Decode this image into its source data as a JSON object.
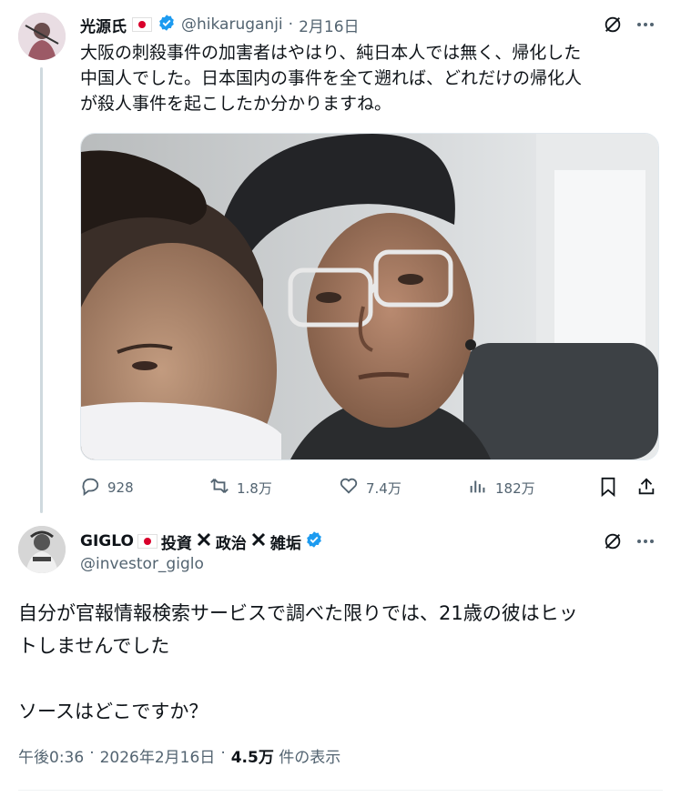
{
  "original_post": {
    "display_name": "光源氏",
    "handle": "@hikaruganji",
    "separator": "·",
    "date": "2月16日",
    "text_lines": [
      "大阪の刺殺事件の加害者はやはり、純日本人では無く、帰化した",
      "中国人でした。日本国内の事件を全て遡れば、どれだけの帰化人",
      "が殺人事件を起こしたか分かりますね。"
    ],
    "stats": {
      "replies": "928",
      "reposts": "1.8万",
      "likes": "7.4万",
      "views": "182万"
    }
  },
  "reply_post": {
    "display_name_prefix": "GIGLO",
    "display_name_suffix_parts": [
      "投資",
      "政治",
      "雑垢"
    ],
    "handle": "@investor_giglo",
    "text_lines": [
      "自分が官報情報検索サービスで調べた限りでは、21歳の彼はヒッ",
      "トしませんでした",
      "",
      "ソースはどこですか？"
    ],
    "time": "午後0:36",
    "sep1": "·",
    "date": "2026年2月16日",
    "sep2": "·",
    "views_count": "4.5万",
    "views_label": "件の表示"
  },
  "colors": {
    "verified_blue": "#1d9bf0",
    "secondary_text": "#536471",
    "flag_red": "#d9002b"
  },
  "icons": [
    "verified-icon",
    "flag-jp-icon",
    "grok-icon",
    "more-icon",
    "reply-icon",
    "repost-icon",
    "like-icon",
    "views-icon",
    "bookmark-icon",
    "share-icon",
    "x-mark-icon"
  ]
}
